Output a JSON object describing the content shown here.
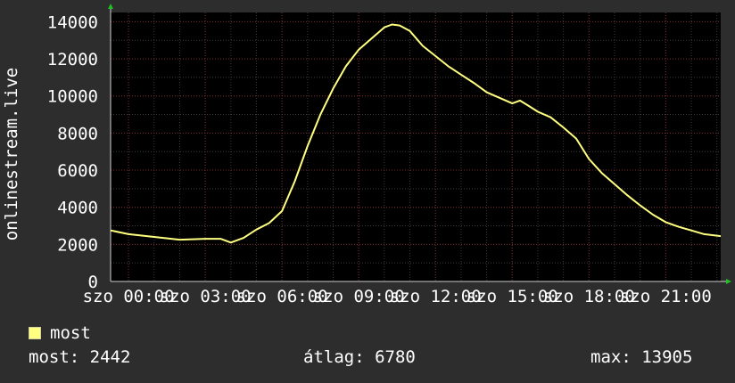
{
  "chart_data": {
    "type": "line",
    "title": "",
    "xlabel": "",
    "ylabel": "onlinestream.live",
    "ylim": [
      0,
      14500
    ],
    "y_ticks": [
      0,
      2000,
      4000,
      6000,
      8000,
      10000,
      12000,
      14000
    ],
    "y_tick_labels": [
      "0",
      "2000",
      "4000",
      "6000",
      "8000",
      "10000",
      "12000",
      "14000"
    ],
    "x_range_hours": [
      -0.7,
      23.15
    ],
    "x_tick_hours": [
      0,
      3,
      6,
      9,
      12,
      15,
      18,
      21
    ],
    "x_tick_labels": [
      "szo 00:00",
      "szo 03:00",
      "szo 06:00",
      "szo 09:00",
      "szo 12:00",
      "szo 15:00",
      "szo 18:00",
      "szo 21:00"
    ],
    "grid": true,
    "background_color": "#000000",
    "page_color": "#2d2d2d",
    "series": [
      {
        "name": "most",
        "color": "#ffff80",
        "x": [
          -0.7,
          0,
          1,
          2,
          3,
          3.6,
          4,
          4.5,
          5,
          5.5,
          6,
          6.5,
          7,
          7.5,
          8,
          8.5,
          9,
          9.5,
          10,
          10.3,
          10.6,
          11,
          11.5,
          12,
          12.5,
          13,
          13.5,
          14,
          14.5,
          15,
          15.3,
          15.6,
          16,
          16.5,
          17,
          17.5,
          18,
          18.5,
          19,
          19.5,
          20,
          20.5,
          21,
          21.5,
          22,
          22.5,
          23.15
        ],
        "values": [
          2750,
          2550,
          2400,
          2250,
          2300,
          2300,
          2100,
          2350,
          2800,
          3150,
          3800,
          5400,
          7300,
          9000,
          10400,
          11600,
          12500,
          13100,
          13700,
          13850,
          13800,
          13500,
          12700,
          12150,
          11600,
          11150,
          10700,
          10200,
          9900,
          9600,
          9750,
          9500,
          9150,
          8850,
          8300,
          7700,
          6600,
          5850,
          5250,
          4650,
          4100,
          3600,
          3200,
          2950,
          2750,
          2550,
          2442
        ]
      }
    ]
  },
  "legend": {
    "series_label": "most"
  },
  "stats": {
    "now": "most: 2442",
    "avg": "átlag: 6780",
    "max": "max: 13905"
  }
}
